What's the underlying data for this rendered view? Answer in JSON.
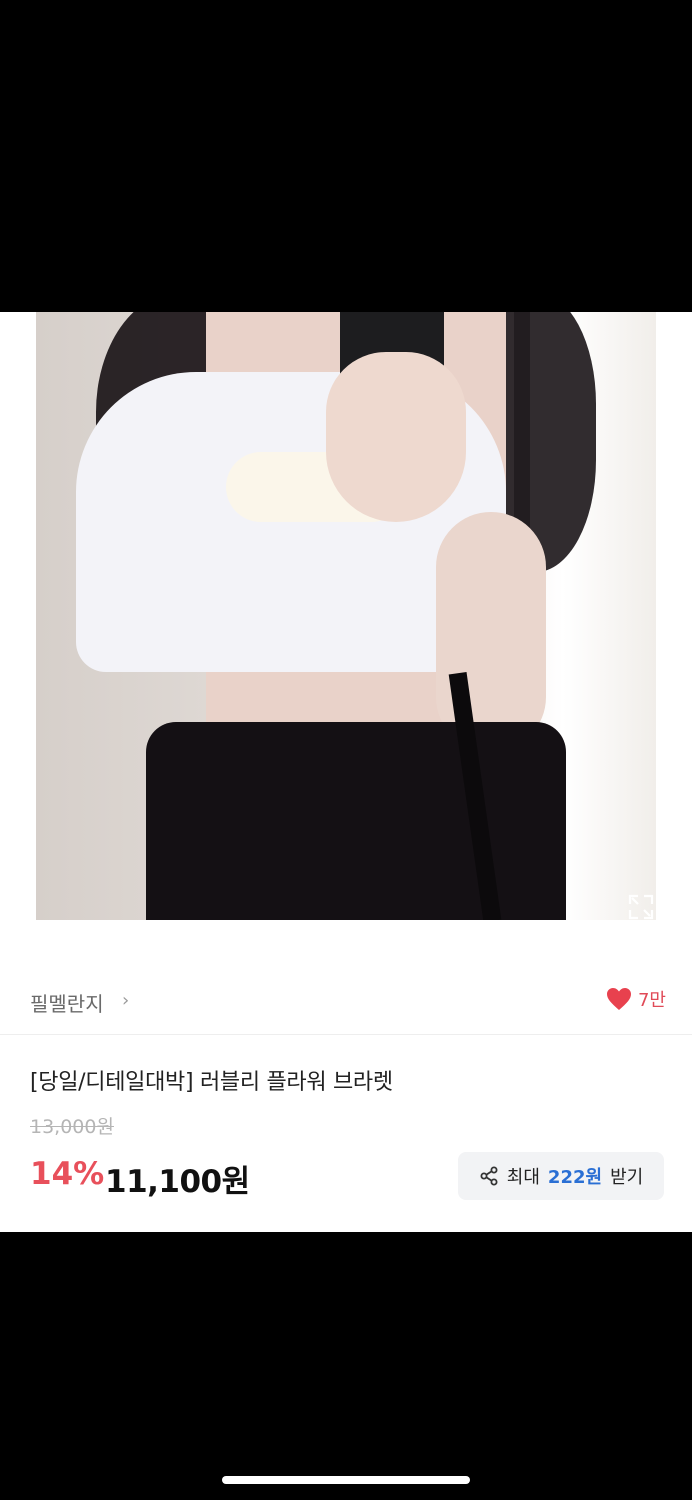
{
  "brand": {
    "name": "필멜란지",
    "chevron": "›"
  },
  "likes": {
    "count": "7만",
    "color": "#e8414e"
  },
  "product": {
    "title": "[당일/디테일대박] 러블리 플라워 브라렛",
    "original_price": "13,000원",
    "discount": "14%",
    "price": "11,100원"
  },
  "reward": {
    "prefix": "최대",
    "amount": "222원",
    "suffix": "받기",
    "accent": "#2a6fd4"
  },
  "icons": {
    "expand": "expand-icon",
    "heart": "heart-icon",
    "share": "share-icon"
  }
}
